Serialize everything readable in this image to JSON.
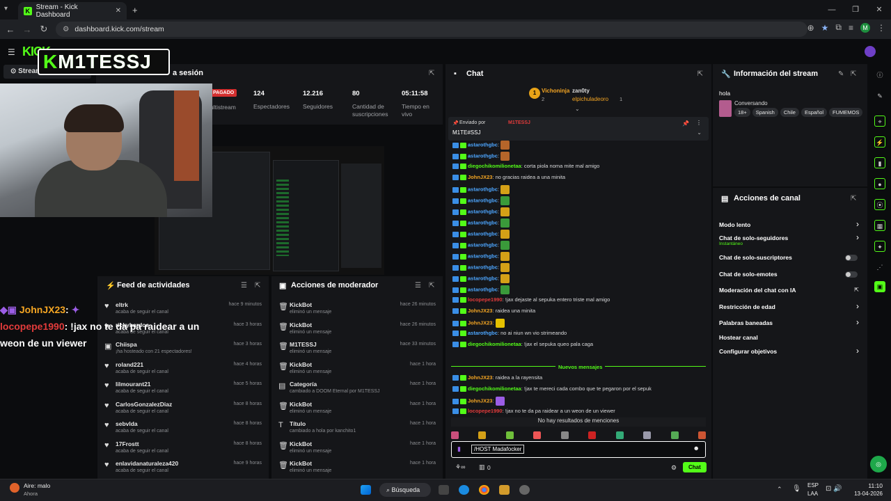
{
  "browser": {
    "tab_title": "Stream - Kick Dashboard",
    "url": "dashboard.kick.com/stream",
    "profile_initial": "M"
  },
  "brand": {
    "k": "K",
    "rest": "M1TESSJ"
  },
  "session": {
    "title_tail": "a sesión",
    "stream_tab": "Stream",
    "pagado": "PAGADO",
    "multistream": "ultistream",
    "stats": [
      {
        "v": "124",
        "l": "Espectadores"
      },
      {
        "v": "12.216",
        "l": "Seguidores"
      },
      {
        "v": "80",
        "l": "Cantidad de suscripciones"
      },
      {
        "v": "05:11:58",
        "l": "Tiempo en vivo"
      }
    ]
  },
  "overlay": [
    {
      "user": "JohnJX23",
      "sep": ":"
    },
    {
      "user": "locopepe1990",
      "text": ": !jax no te da pa raidear a un"
    },
    {
      "text": "weon de un viewer"
    }
  ],
  "activity": {
    "title": "Feed de actividades",
    "items": [
      {
        "n": "eltrk",
        "s": "acaba de seguir el canal",
        "t": "hace 9 minutos",
        "i": "♥"
      },
      {
        "n": "rickyhardos",
        "s": "acaba de seguir el canal",
        "t": "hace 3 horas",
        "i": "♥"
      },
      {
        "n": "Chiispa",
        "s": "¡ha hosteado con 21 espectadores!",
        "t": "hace 3 horas",
        "i": "▣"
      },
      {
        "n": "roland221",
        "s": "acaba de seguir el canal",
        "t": "hace 4 horas",
        "i": "♥"
      },
      {
        "n": "lilmourant21",
        "s": "acaba de seguir el canal",
        "t": "hace 5 horas",
        "i": "♥"
      },
      {
        "n": "CarlosGonzalezDiaz",
        "s": "acaba de seguir el canal",
        "t": "hace 8 horas",
        "i": "♥"
      },
      {
        "n": "sebvlda",
        "s": "acaba de seguir el canal",
        "t": "hace 8 horas",
        "i": "♥"
      },
      {
        "n": "17Frostt",
        "s": "acaba de seguir el canal",
        "t": "hace 8 horas",
        "i": "♥"
      },
      {
        "n": "enlavidanaturaleza420",
        "s": "acaba de seguir el canal",
        "t": "hace 9 horas",
        "i": "♥"
      }
    ]
  },
  "mod": {
    "title": "Acciones de moderador",
    "items": [
      {
        "n": "KickBot",
        "s": "eliminó un mensaje",
        "t": "hace 26 minutos",
        "i": "🗑"
      },
      {
        "n": "KickBot",
        "s": "eliminó un mensaje",
        "t": "hace 26 minutos",
        "i": "🗑"
      },
      {
        "n": "M1TESSJ",
        "s": "eliminó un mensaje",
        "t": "hace 33 minutos",
        "i": "🗑"
      },
      {
        "n": "KickBot",
        "s": "eliminó un mensaje",
        "t": "hace 1 hora",
        "i": "🗑"
      },
      {
        "n": "Categoría",
        "s": "cambiado a DOOM Eternal por M1TESSJ",
        "t": "hace 1 hora",
        "i": "▤"
      },
      {
        "n": "KickBot",
        "s": "eliminó un mensaje",
        "t": "hace 1 hora",
        "i": "🗑"
      },
      {
        "n": "Título",
        "s": "cambiado a hola por kanchito1",
        "t": "hace 1 hora",
        "i": "T"
      },
      {
        "n": "KickBot",
        "s": "eliminó un mensaje",
        "t": "hace 1 hora",
        "i": "🗑"
      },
      {
        "n": "KickBot",
        "s": "eliminó un mensaje",
        "t": "hace 1 hora",
        "i": "🗑"
      }
    ]
  },
  "chat": {
    "title": "Chat",
    "top1": "Vichoninja",
    "top1n": "2",
    "top2": "zan0ty",
    "top3": "elpichuladeoro",
    "top3n": "1",
    "pinned_by": "Enviado por",
    "pinned_user": "M1TESSJ",
    "pinned_msg": "M1TE#SSJ",
    "lines": [
      {
        "u": "astarothgbc",
        "c": "#4da6ff",
        "m": "",
        "e": "#b5652a"
      },
      {
        "u": "astarothgbc",
        "c": "#4da6ff",
        "m": "",
        "e": "#b5652a"
      },
      {
        "u": "diegochikomilionetaa",
        "c": "#53fc18",
        "m": "corta piola noma mite mal amigo",
        "e": ""
      },
      {
        "u": "JohnJX23",
        "c": "#f5a623",
        "m": "no gracias raidea a una minita",
        "e": ""
      },
      {
        "u": "astarothgbc",
        "c": "#4da6ff",
        "m": "",
        "e": "#d4a017"
      },
      {
        "u": "astarothgbc",
        "c": "#4da6ff",
        "m": "",
        "e": "#3a9a3a"
      },
      {
        "u": "astarothgbc",
        "c": "#4da6ff",
        "m": "",
        "e": "#d4a017"
      },
      {
        "u": "astarothgbc",
        "c": "#4da6ff",
        "m": "",
        "e": "#3a9a3a"
      },
      {
        "u": "astarothgbc",
        "c": "#4da6ff",
        "m": "",
        "e": "#d4a017"
      },
      {
        "u": "astarothgbc",
        "c": "#4da6ff",
        "m": "",
        "e": "#3a9a3a"
      },
      {
        "u": "astarothgbc",
        "c": "#4da6ff",
        "m": "",
        "e": "#d4a017"
      },
      {
        "u": "astarothgbc",
        "c": "#4da6ff",
        "m": "",
        "e": "#d4a017"
      },
      {
        "u": "astarothgbc",
        "c": "#4da6ff",
        "m": "",
        "e": "#d4a017"
      },
      {
        "u": "astarothgbc",
        "c": "#4da6ff",
        "m": "",
        "e": "#3a9a3a"
      },
      {
        "u": "locopepe1990",
        "c": "#e23b3b",
        "m": "!jax dejaste al sepuka entero triste mal amigo",
        "e": ""
      },
      {
        "u": "JohnJX23",
        "c": "#f5a623",
        "m": "raidea una minita",
        "e": ""
      },
      {
        "u": "JohnJX23",
        "c": "#f5a623",
        "m": "",
        "e": "#e5c100"
      },
      {
        "u": "astarothgbc",
        "c": "#4da6ff",
        "m": "no ai niun wn vio strimeando",
        "e": ""
      },
      {
        "u": "diegochikomilionetaa",
        "c": "#53fc18",
        "m": "!jax el sepuka queo pala caga",
        "e": ""
      }
    ],
    "new_msgs": "Nuevos mensajes",
    "lines2": [
      {
        "u": "JohnJX23",
        "c": "#f5a623",
        "m": "raidea a la rayensita",
        "e": ""
      },
      {
        "u": "diegochikomilionetaa",
        "c": "#53fc18",
        "m": "!jax te mereci cada combo que te pegaron por el sepuk",
        "e": ""
      },
      {
        "u": "JohnJX23",
        "c": "#f5a623",
        "m": "",
        "e": "#9b5de5"
      },
      {
        "u": "locopepe1990",
        "c": "#e23b3b",
        "m": "!jax no te da pa raidear a un weon de un viewer",
        "e": ""
      }
    ],
    "no_mentions": "No hay resultados de menciones",
    "input_value": "/HOST Madafocker",
    "send": "Chat",
    "viewers_count": "0"
  },
  "info": {
    "title": "Información del stream",
    "stream_title": "hola",
    "category": "Conversando",
    "tags": [
      "18+",
      "Spanish",
      "Chile",
      "Español",
      "FUMEMOS"
    ]
  },
  "actions": {
    "title": "Acciones de canal",
    "items": [
      {
        "n": "Modo lento",
        "k": "chev"
      },
      {
        "n": "Chat de solo-seguidores",
        "sub": "Instantáneo",
        "k": "chev"
      },
      {
        "n": "Chat de solo-suscriptores",
        "k": "tog"
      },
      {
        "n": "Chat de solo-emotes",
        "k": "tog"
      },
      {
        "n": "Moderación del chat con IA",
        "k": "ext"
      },
      {
        "n": "Restricción de edad",
        "k": "chev"
      },
      {
        "n": "Palabras baneadas",
        "k": "chev"
      },
      {
        "n": "Hostear canal",
        "k": ""
      },
      {
        "n": "Configurar objetivos",
        "k": "chev"
      }
    ]
  },
  "taskbar": {
    "weather": "Aire: malo",
    "weather_sub": "Ahora",
    "search": "Búsqueda",
    "lang1": "ESP",
    "lang2": "LAA",
    "time": "11:10",
    "date": "13-04-2026"
  }
}
